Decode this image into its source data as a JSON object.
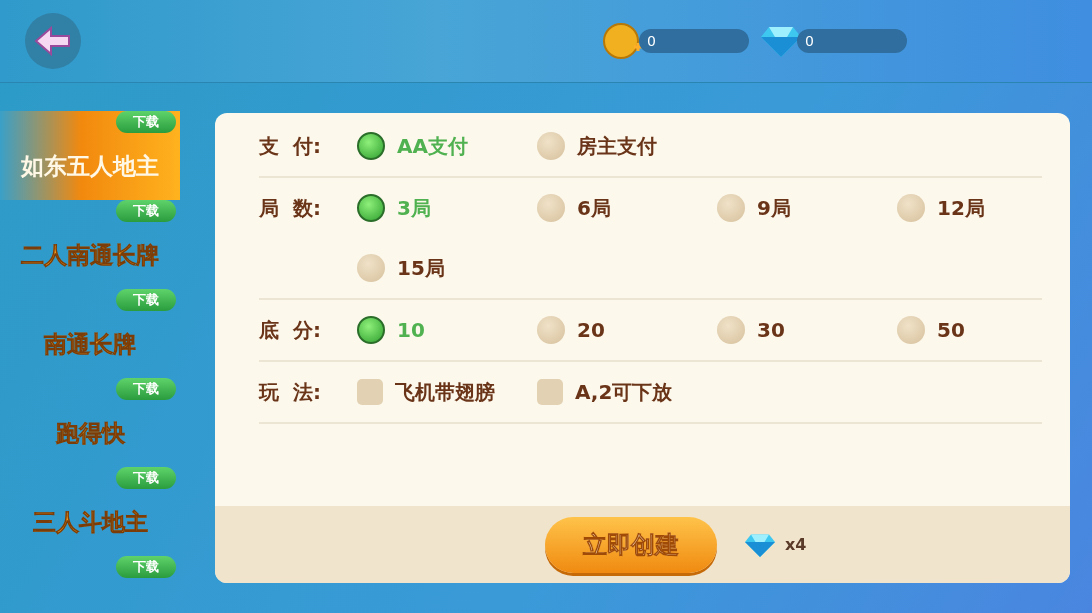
{
  "top_bar": {
    "coins": "0",
    "diamonds": "0"
  },
  "sidebar": {
    "items": [
      {
        "label": "如东五人地主",
        "badge": "下载",
        "selected": true
      },
      {
        "label": "二人南通长牌",
        "badge": "下载",
        "selected": false
      },
      {
        "label": "南通长牌",
        "badge": "下载",
        "selected": false
      },
      {
        "label": "跑得快",
        "badge": "下载",
        "selected": false
      },
      {
        "label": "三人斗地主",
        "badge": "下载",
        "selected": false
      },
      {
        "badge": "下载",
        "selected": false
      }
    ]
  },
  "settings": [
    {
      "label": "支  付:",
      "kind": "radio",
      "options": [
        {
          "label": "AA支付",
          "selected": true
        },
        {
          "label": "房主支付",
          "selected": false
        }
      ]
    },
    {
      "label": "局  数:",
      "kind": "radio",
      "options": [
        {
          "label": "3局",
          "selected": true
        },
        {
          "label": "6局",
          "selected": false
        },
        {
          "label": "9局",
          "selected": false
        },
        {
          "label": "12局",
          "selected": false
        },
        {
          "label": "15局",
          "selected": false
        }
      ]
    },
    {
      "label": "底  分:",
      "kind": "radio",
      "options": [
        {
          "label": "10",
          "selected": true
        },
        {
          "label": "20",
          "selected": false
        },
        {
          "label": "30",
          "selected": false
        },
        {
          "label": "50",
          "selected": false
        }
      ]
    },
    {
      "label": "玩  法:",
      "kind": "checkbox",
      "options": [
        {
          "label": "飞机带翅膀",
          "checked": false
        },
        {
          "label": "A,2可下放",
          "checked": false
        }
      ]
    }
  ],
  "footer": {
    "create_button": "立即创建",
    "cost": "x4"
  }
}
